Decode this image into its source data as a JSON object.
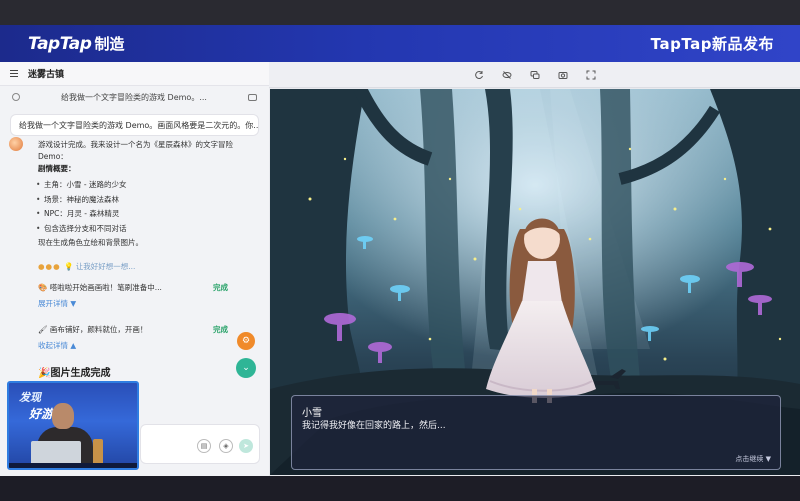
{
  "banner": {
    "logo_en": "TapTap",
    "logo_zh": "制造",
    "right_title": "TapTap新品发布"
  },
  "chat": {
    "title": "迷雾古镇",
    "history_preview": "给我做一个文字冒险类的游戏 Demo。...",
    "user_message": "给我做一个文字冒险类的游戏 Demo。画面风格要是二次元的。你...",
    "reply_intro": "游戏设计完成。我来设计一个名为《星辰森林》的文字冒险 Demo：",
    "plot_heading": "剧情概要：",
    "plot_items": [
      "主角：小雪 - 迷路的少女",
      "场景：神秘的魔法森林",
      "NPC：月灵 - 森林精灵",
      "包含选择分支和不同对话"
    ],
    "reply_after": "现在生成角色立绘和背景图片。",
    "thinking": "让我好好想一想...",
    "status_1": {
      "text": "嗒啦啦开始画画啦！笔刷准备中...",
      "state": "完成",
      "toggle": "展开详情 ▼"
    },
    "status_2": {
      "text": "画布铺好，颜料就位，开画！",
      "state": "完成",
      "toggle": "收起详情 ▲"
    },
    "image_done": "图片生成完成"
  },
  "webcam": {
    "overlay_line1": "发现",
    "overlay_line2": "好游戏"
  },
  "game": {
    "speaker": "小雪",
    "line": "我记得我好像在回家的路上，然后...",
    "hint": "点击继续 ▼"
  },
  "colors": {
    "banner": "#2337b0",
    "accent_green": "#2fb596",
    "accent_orange": "#f08a2a",
    "done_green": "#2aa36a",
    "link_blue": "#4a8ad6"
  },
  "icons": {
    "toolbar": [
      "refresh-icon",
      "hide-icon",
      "chat-icon",
      "camera-icon",
      "fullscreen-icon"
    ]
  }
}
